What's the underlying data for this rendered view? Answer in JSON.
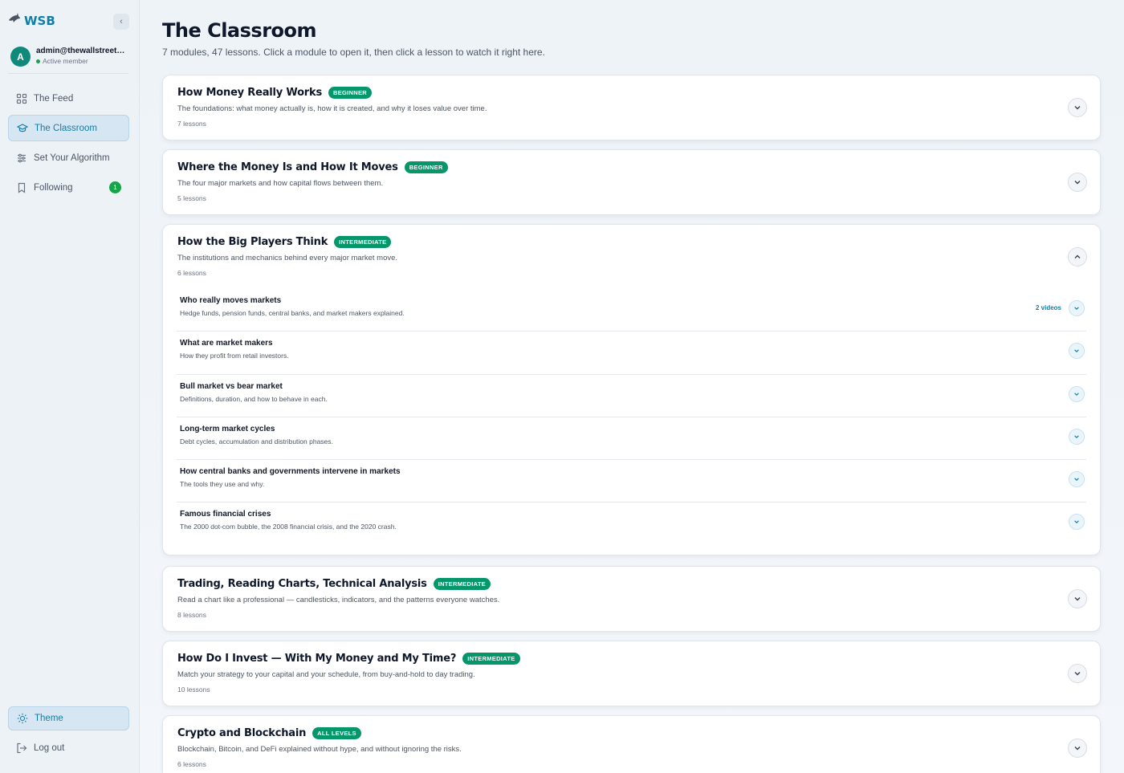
{
  "brand": {
    "name": "WSB",
    "logo_icon": "shark-icon"
  },
  "sidebar": {
    "collapse_label": "‹",
    "user": {
      "initial": "A",
      "email": "admin@thewallstreetb…",
      "status": "Active member"
    },
    "nav": [
      {
        "label": "The Feed",
        "icon": "grid-icon",
        "active": false
      },
      {
        "label": "The Classroom",
        "icon": "graduation-cap-icon",
        "active": true
      },
      {
        "label": "Set Your Algorithm",
        "icon": "sliders-icon",
        "active": false
      },
      {
        "label": "Following",
        "icon": "bookmark-icon",
        "active": false,
        "badge": "1"
      }
    ],
    "theme_label": "Theme",
    "logout_label": "Log out"
  },
  "page": {
    "title": "The Classroom",
    "subtitle": "7 modules, 47 lessons. Click a module to open it, then click a lesson to watch it right here."
  },
  "modules": [
    {
      "title": "How Money Really Works",
      "level": "BEGINNER",
      "desc": "The foundations: what money actually is, how it is created, and why it loses value over time.",
      "count": "7 lessons",
      "expanded": false
    },
    {
      "title": "Where the Money Is and How It Moves",
      "level": "BEGINNER",
      "desc": "The four major markets and how capital flows between them.",
      "count": "5 lessons",
      "expanded": false
    },
    {
      "title": "How the Big Players Think",
      "level": "INTERMEDIATE",
      "desc": "The institutions and mechanics behind every major market move.",
      "count": "6 lessons",
      "expanded": true,
      "lessons": [
        {
          "title": "Who really moves markets",
          "desc": "Hedge funds, pension funds, central banks, and market makers explained.",
          "videos": "2 videos"
        },
        {
          "title": "What are market makers",
          "desc": "How they profit from retail investors.",
          "videos": ""
        },
        {
          "title": "Bull market vs bear market",
          "desc": "Definitions, duration, and how to behave in each.",
          "videos": ""
        },
        {
          "title": "Long-term market cycles",
          "desc": "Debt cycles, accumulation and distribution phases.",
          "videos": ""
        },
        {
          "title": "How central banks and governments intervene in markets",
          "desc": "The tools they use and why.",
          "videos": ""
        },
        {
          "title": "Famous financial crises",
          "desc": "The 2000 dot-com bubble, the 2008 financial crisis, and the 2020 crash.",
          "videos": ""
        }
      ]
    },
    {
      "title": "Trading, Reading Charts, Technical Analysis",
      "level": "INTERMEDIATE",
      "desc": "Read a chart like a professional — candlesticks, indicators, and the patterns everyone watches.",
      "count": "8 lessons",
      "expanded": false
    },
    {
      "title": "How Do I Invest — With My Money and My Time?",
      "level": "INTERMEDIATE",
      "desc": "Match your strategy to your capital and your schedule, from buy-and-hold to day trading.",
      "count": "10 lessons",
      "expanded": false
    },
    {
      "title": "Crypto and Blockchain",
      "level": "ALL LEVELS",
      "desc": "Blockchain, Bitcoin, and DeFi explained without hype, and without ignoring the risks.",
      "count": "6 lessons",
      "expanded": false
    }
  ]
}
